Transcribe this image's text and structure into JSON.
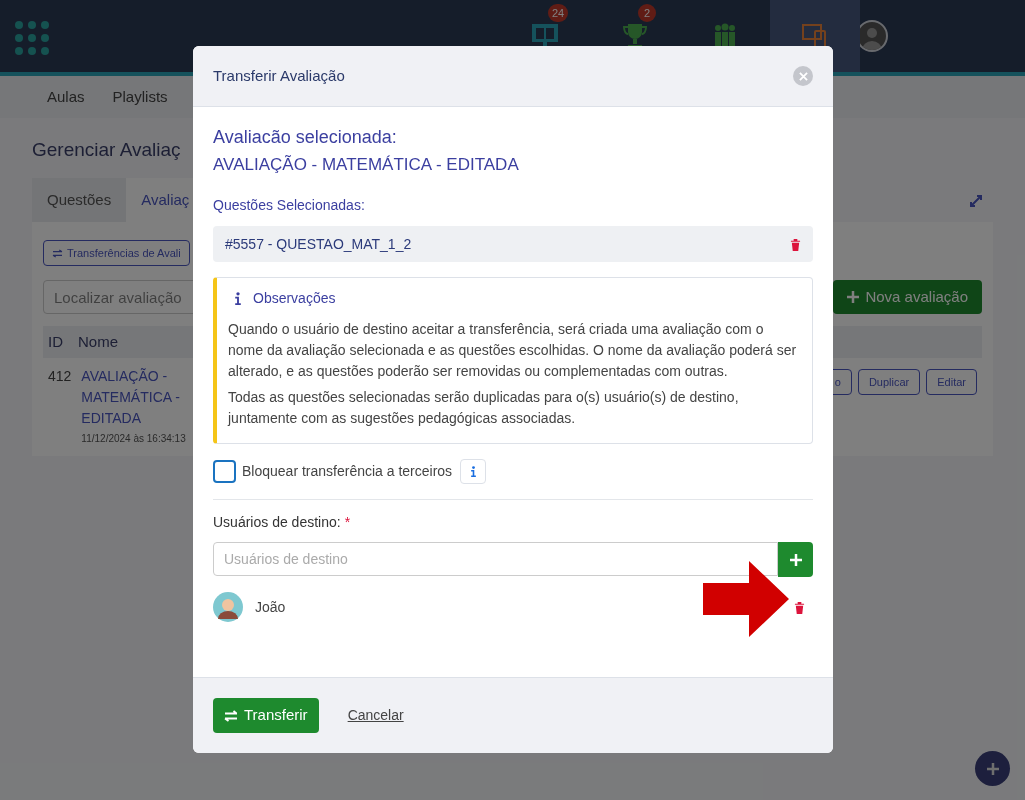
{
  "background": {
    "nav": [
      {
        "badge": "24",
        "selected": false
      },
      {
        "badge": "2",
        "selected": false
      },
      {
        "selected": false
      },
      {
        "selected": true
      }
    ],
    "subnav": [
      "Aulas",
      "Playlists"
    ],
    "title": "Gerenciar Avaliaç",
    "tabs": [
      {
        "label": "Questões",
        "selected": false
      },
      {
        "label": "Avaliaç",
        "selected": true
      }
    ],
    "transfers_button": "Transferências de Avali",
    "search": {
      "placeholder": "Localizar avaliação"
    },
    "new_button": "Nova avaliação",
    "table": {
      "columns": [
        "ID",
        "Nome"
      ],
      "rows": [
        {
          "id": "412",
          "name": "AVALIAÇÃO - MATEMÁTICA - EDITADA",
          "date": "11/12/2024 às 16:34:13",
          "actions": [
            "o",
            "Duplicar",
            "Editar"
          ]
        }
      ]
    }
  },
  "modal": {
    "title": "Transferir Avaliação",
    "selected_label": "Avaliacão selecionada:",
    "selected_name": "AVALIAÇÃO - MATEMÁTICA - EDITADA",
    "questions_label": "Questões Selecionadas:",
    "questions": [
      "#5557 - QUESTAO_MAT_1_2"
    ],
    "notes": {
      "title": "Observações",
      "paragraphs": [
        "Quando o usuário de destino aceitar a transferência, será criada uma avaliação com o nome da avaliação selecionada e as questões escolhidas. O nome da avaliação poderá ser alterado, e as questões poderão ser removidas ou complementadas com outras.",
        "Todas as questões selecionadas serão duplicadas para o(s) usuário(s) de destino, juntamente com as sugestões pedagógicas associadas."
      ]
    },
    "block_option": {
      "label": "Bloquear transferência a terceiros",
      "checked": false
    },
    "users_label": "Usuários de destino:",
    "required_mark": "*",
    "users_field": {
      "placeholder": "Usuários de destino"
    },
    "users": [
      {
        "name": "João"
      }
    ],
    "submit": "Transferir",
    "cancel": "Cancelar"
  }
}
